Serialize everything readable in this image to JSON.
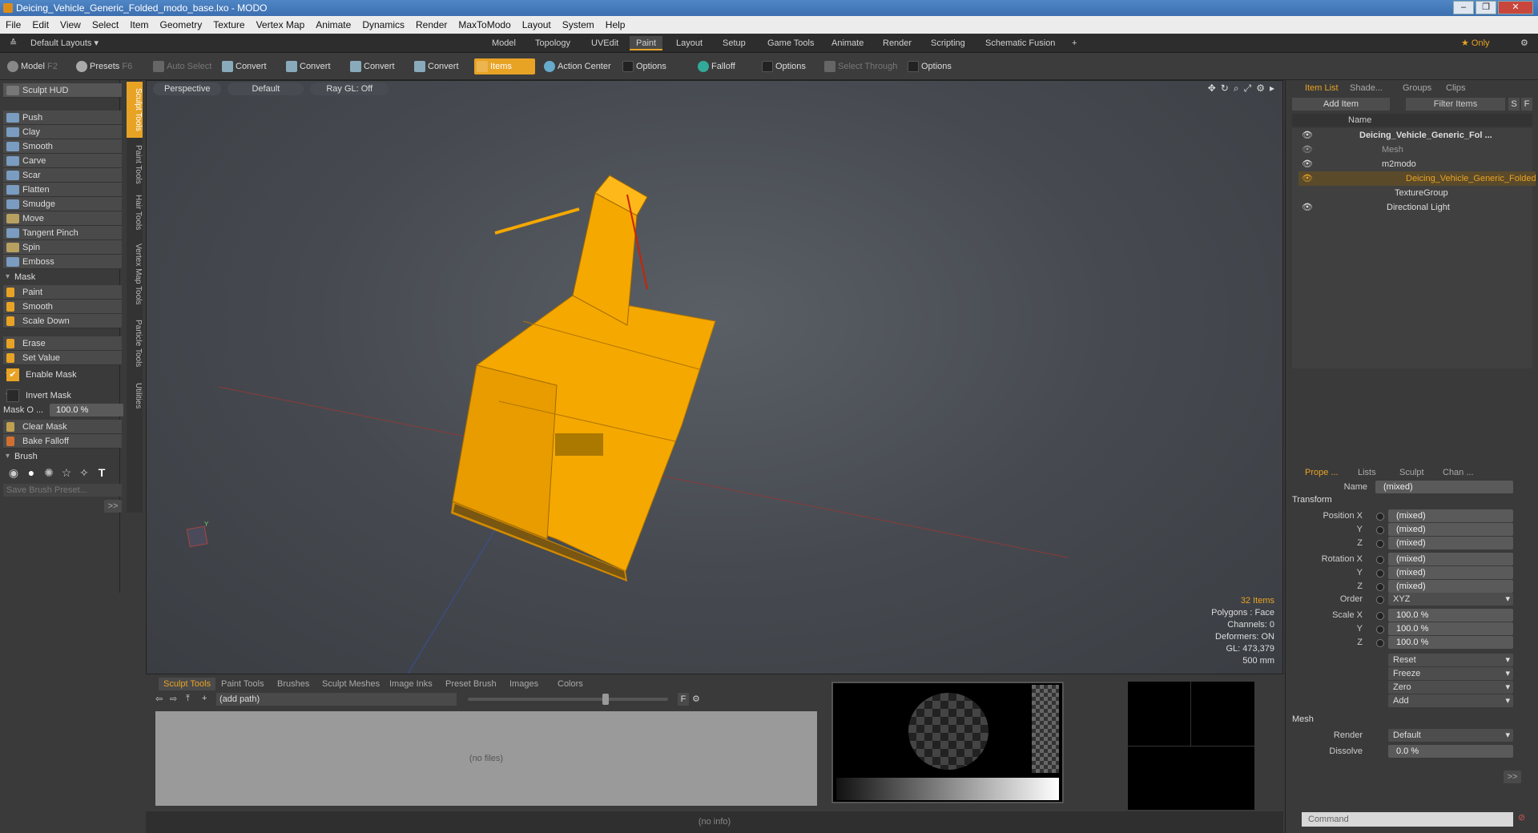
{
  "window": {
    "title": "Deicing_Vehicle_Generic_Folded_modo_base.lxo - MODO"
  },
  "menu": [
    "File",
    "Edit",
    "View",
    "Select",
    "Item",
    "Geometry",
    "Texture",
    "Vertex Map",
    "Animate",
    "Dynamics",
    "Render",
    "MaxToModo",
    "Layout",
    "System",
    "Help"
  ],
  "layoutbar": {
    "layouts_label": "Default Layouts ▾",
    "tabs": [
      "Model",
      "Topology",
      "UVEdit",
      "Paint",
      "Layout",
      "Setup",
      "Game Tools",
      "Animate",
      "Render",
      "Scripting",
      "Schematic Fusion"
    ],
    "active_tab": "Paint",
    "plus": "+",
    "only_label": "★  Only"
  },
  "toolbar": {
    "model": "Model",
    "model_key": "F2",
    "presets": "Presets",
    "presets_key": "F6",
    "auto_select": "Auto Select",
    "convert": "Convert",
    "items": "Items",
    "action_center": "Action Center",
    "options": "Options",
    "falloff": "Falloff",
    "select_through": "Select Through"
  },
  "left_panel": {
    "hud": "Sculpt HUD",
    "tools": [
      "Push",
      "Clay",
      "Smooth",
      "Carve",
      "Scar",
      "Flatten",
      "Smudge",
      "Move",
      "Tangent Pinch",
      "Spin",
      "Emboss"
    ],
    "mask_section": "Mask",
    "mask_tools": [
      "Paint",
      "Smooth",
      "Scale Down"
    ],
    "mask_tools2": [
      "Erase",
      "Set Value"
    ],
    "enable_mask": "Enable Mask",
    "invert_mask": "Invert Mask",
    "mask_opacity_label": "Mask O ...",
    "mask_opacity_value": "100.0 %",
    "clear_mask": "Clear Mask",
    "bake_falloff": "Bake Falloff",
    "brush_section": "Brush",
    "save_brush": "Save Brush Preset...",
    "more": ">>"
  },
  "vertical_tabs": [
    "Sculpt Tools",
    "Paint Tools",
    "Hair Tools",
    "Vertex Map Tools",
    "Particle Tools",
    "Utilities"
  ],
  "viewport": {
    "view": "Perspective",
    "shading": "Default",
    "raygl": "Ray GL: Off",
    "info": {
      "items": "32 Items",
      "polygons": "Polygons : Face",
      "channels": "Channels: 0",
      "deformers": "Deformers: ON",
      "gl": "GL: 473,379",
      "unit": "500 mm"
    }
  },
  "bottom_panel": {
    "tabs": [
      "Sculpt Tools",
      "Paint Tools",
      "Brushes",
      "Sculpt Meshes",
      "Image Inks",
      "Preset Brush",
      "Images",
      "Colors"
    ],
    "active_tab": "Sculpt Tools",
    "path_placeholder": "(add path)",
    "no_files": "(no files)",
    "f_button": "F"
  },
  "status": "(no info)",
  "item_list": {
    "tabs": [
      "Item List",
      "Shade...",
      "Groups",
      "Clips"
    ],
    "add_item": "Add Item",
    "filter": "Filter Items",
    "s": "S",
    "f": "F",
    "name_col": "Name",
    "rows": [
      {
        "label": "Deicing_Vehicle_Generic_Fol ..."
      },
      {
        "label": "Mesh"
      },
      {
        "label": "m2modo"
      },
      {
        "label": "Deicing_Vehicle_Generic_Folded"
      },
      {
        "label": "TextureGroup"
      },
      {
        "label": "Directional Light"
      }
    ]
  },
  "properties": {
    "tabs": [
      "Prope ...",
      "Lists",
      "Sculpt",
      "Chan ..."
    ],
    "name_label": "Name",
    "name_value": "(mixed)",
    "transform": "Transform",
    "position_x": "Position X",
    "y": "Y",
    "z": "Z",
    "mixed": "(mixed)",
    "rotation_x": "Rotation X",
    "order": "Order",
    "order_value": "XYZ",
    "scale_x": "Scale X",
    "scale_value": "100.0 %",
    "reset": "Reset",
    "freeze": "Freeze",
    "zero": "Zero",
    "add": "Add",
    "mesh": "Mesh",
    "render": "Render",
    "render_value": "Default",
    "dissolve": "Dissolve",
    "dissolve_value": "0.0 %",
    "more": ">>"
  },
  "command": {
    "placeholder": "Command"
  },
  "colors": {
    "accent": "#e8a325",
    "vehicle": "#f5a800"
  }
}
